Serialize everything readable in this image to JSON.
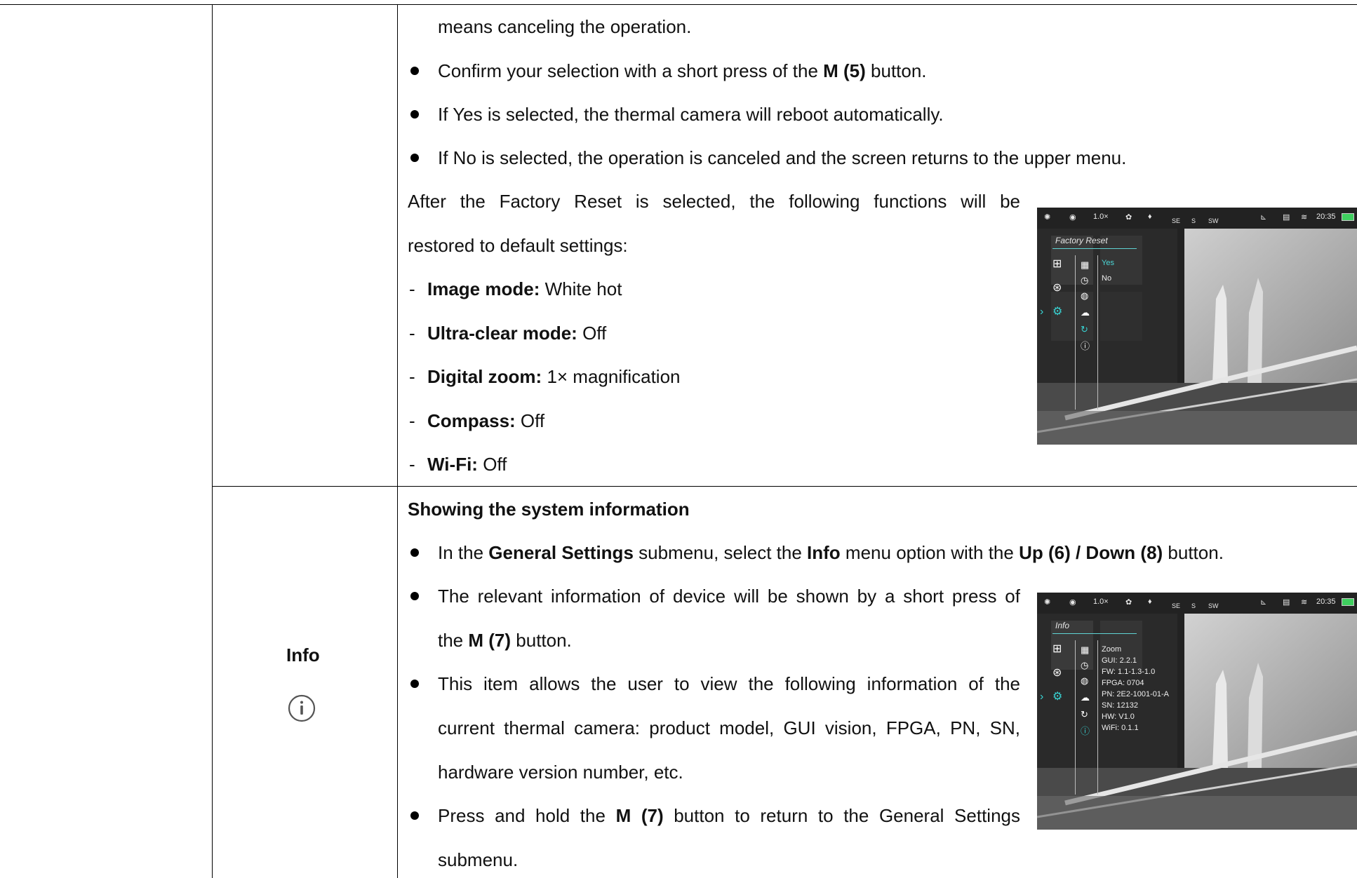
{
  "reset_section": {
    "intro_tail": "means canceling the operation.",
    "bullets": [
      {
        "pre": "Confirm your selection with a short press of the ",
        "bold": "M (5)",
        "post": " button."
      },
      {
        "text": "If Yes is selected, the thermal camera will reboot automatically."
      },
      {
        "text": "If No is selected, the operation is canceled and the screen returns to the upper menu."
      }
    ],
    "after_line1": "After the Factory Reset is selected, the following functions will be",
    "after_line2": "restored to default settings:",
    "defaults": [
      {
        "label": "Image mode:",
        "value": " White hot"
      },
      {
        "label": "Ultra-clear mode:",
        "value": " Off"
      },
      {
        "label": "Digital zoom:",
        "value": " 1× magnification"
      },
      {
        "label": "Compass:",
        "value": " Off"
      },
      {
        "label": "Wi-Fi:",
        "value": " Off"
      }
    ],
    "screen": {
      "zoom": "1.0×",
      "compass": [
        "SE",
        "S",
        "SW"
      ],
      "time": "20:35",
      "menu_title": "Factory Reset",
      "options": [
        "Yes",
        "No"
      ]
    }
  },
  "info_section": {
    "row_label": "Info",
    "icon": "info-circle-icon",
    "heading": "Showing the system information",
    "b1": {
      "p1": "In the ",
      "b1": "General Settings",
      "p2": " submenu, select the ",
      "b2": "Info",
      "p3": " menu option with the ",
      "b3": "Up (6) / Down (8)",
      "p4": " button."
    },
    "b2_line1": "The relevant information of device will be shown by a short press of",
    "b2_line2": {
      "p1": "the ",
      "b": "M (7)",
      "p2": " button."
    },
    "b3_line1": "This item allows the user to view the following information of the",
    "b3_line2": "current thermal camera: product model, GUI vision, FPGA, PN, SN,",
    "b3_line3": "hardware version number, etc.",
    "b4_line1": {
      "p1": "Press and hold the ",
      "b": "M (7)",
      "p2": " button to return to the General Settings"
    },
    "b4_line2": "submenu.",
    "screen": {
      "zoom": "1.0×",
      "compass": [
        "SE",
        "S",
        "SW"
      ],
      "time": "20:35",
      "menu_title": "Info",
      "info_lines": [
        "Zoom",
        "GUI: 2.2.1",
        "FW: 1.1-1.3-1.0",
        "FPGA: 0704",
        "PN: 2E2-1001-01-A",
        "SN: 12132",
        "HW: V1.0",
        "WiFi: 0.1.1"
      ]
    }
  }
}
